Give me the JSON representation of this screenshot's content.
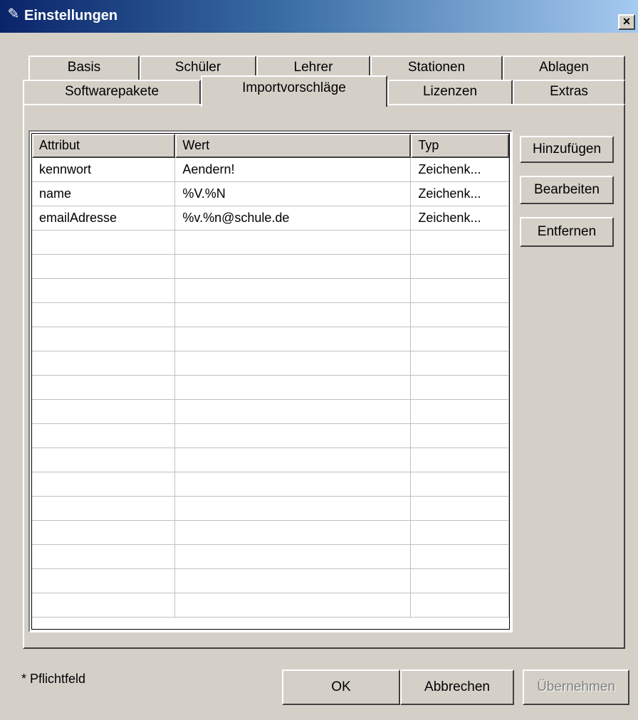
{
  "window": {
    "title": "Einstellungen",
    "icon": "settings-pen-icon",
    "close_label": "×"
  },
  "tabs_row1": [
    "Basis",
    "Schüler",
    "Lehrer",
    "Stationen",
    "Ablagen"
  ],
  "tabs_row2": [
    "Softwarepakete",
    "Importvorschläge",
    "Lizenzen",
    "Extras"
  ],
  "active_tab": "Importvorschläge",
  "table": {
    "headers": [
      "Attribut",
      "Wert",
      "Typ"
    ],
    "rows": [
      [
        "kennwort",
        "Aendern!",
        "Zeichenk..."
      ],
      [
        "name",
        "%V.%N",
        "Zeichenk..."
      ],
      [
        "emailAdresse",
        "%v.%n@schule.de",
        "Zeichenk..."
      ]
    ]
  },
  "side_buttons": {
    "add": "Hinzufügen",
    "edit": "Bearbeiten",
    "remove": "Entfernen"
  },
  "footer": {
    "required_note": "* Pflichtfeld",
    "ok": "OK",
    "cancel": "Abbrechen",
    "apply": "Übernehmen"
  }
}
